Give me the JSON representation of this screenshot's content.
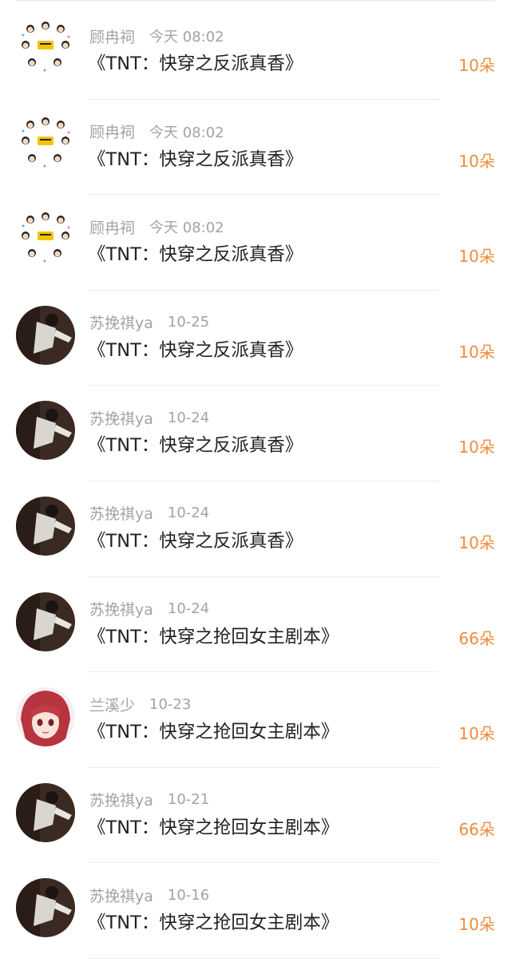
{
  "colors": {
    "accent": "#ef8c3d",
    "username": "#a3a3a3",
    "title": "#222222"
  },
  "items": [
    {
      "user": "顾冉祠",
      "time": "今天 08:02",
      "title": "《TNT：快穿之反派真香》",
      "amount": "10朵",
      "avatar": "group-cartoon-avatar"
    },
    {
      "user": "顾冉祠",
      "time": "今天 08:02",
      "title": "《TNT：快穿之反派真香》",
      "amount": "10朵",
      "avatar": "group-cartoon-avatar"
    },
    {
      "user": "顾冉祠",
      "time": "今天 08:02",
      "title": "《TNT：快穿之反派真香》",
      "amount": "10朵",
      "avatar": "group-cartoon-avatar"
    },
    {
      "user": "苏挽祺ya",
      "time": "10-25",
      "title": "《TNT：快穿之反派真香》",
      "amount": "10朵",
      "avatar": "dark-photo-avatar"
    },
    {
      "user": "苏挽祺ya",
      "time": "10-24",
      "title": "《TNT：快穿之反派真香》",
      "amount": "10朵",
      "avatar": "dark-photo-avatar"
    },
    {
      "user": "苏挽祺ya",
      "time": "10-24",
      "title": "《TNT：快穿之反派真香》",
      "amount": "10朵",
      "avatar": "dark-photo-avatar"
    },
    {
      "user": "苏挽祺ya",
      "time": "10-24",
      "title": "《TNT：快穿之抢回女主剧本》",
      "amount": "66朵",
      "avatar": "dark-photo-avatar"
    },
    {
      "user": "兰溪少",
      "time": "10-23",
      "title": "《TNT：快穿之抢回女主剧本》",
      "amount": "10朵",
      "avatar": "anime-girl-avatar"
    },
    {
      "user": "苏挽祺ya",
      "time": "10-21",
      "title": "《TNT：快穿之抢回女主剧本》",
      "amount": "66朵",
      "avatar": "dark-photo-avatar"
    },
    {
      "user": "苏挽祺ya",
      "time": "10-16",
      "title": "《TNT：快穿之抢回女主剧本》",
      "amount": "10朵",
      "avatar": "dark-photo-avatar"
    }
  ]
}
